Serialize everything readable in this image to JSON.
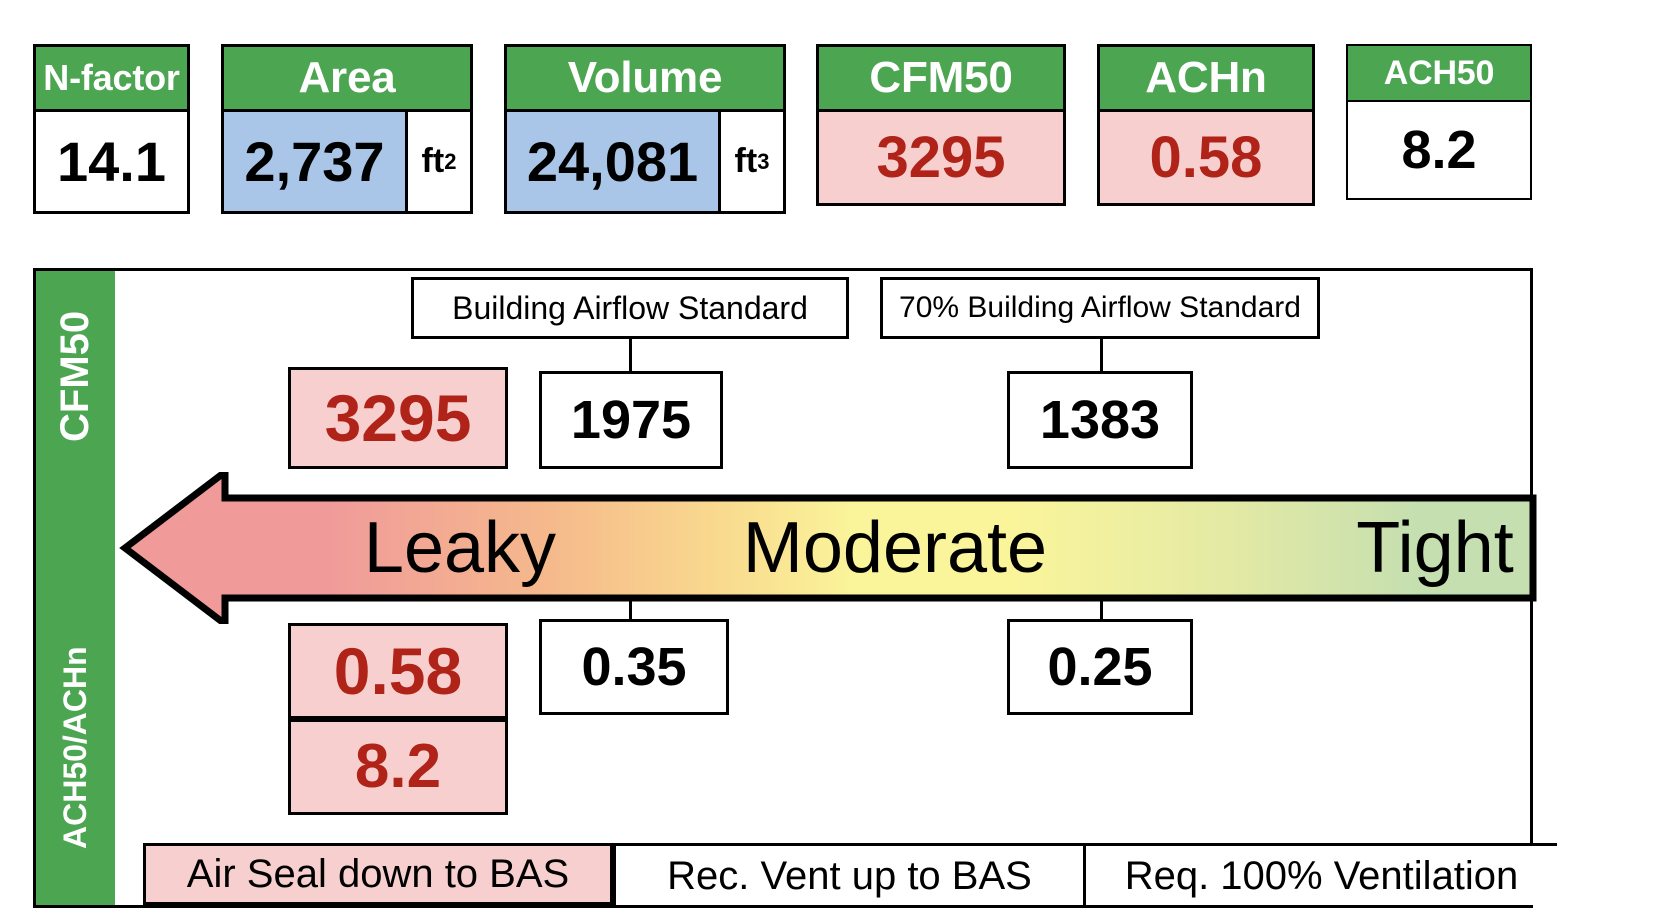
{
  "summary": {
    "cards": [
      {
        "id": "nfactor",
        "label": "N-factor",
        "value": "14.1",
        "unit": "",
        "unit_sup": ""
      },
      {
        "id": "area",
        "label": "Area",
        "value": "2,737",
        "unit": "ft",
        "unit_sup": "2"
      },
      {
        "id": "volume",
        "label": "Volume",
        "value": "24,081",
        "unit": "ft",
        "unit_sup": "3"
      },
      {
        "id": "cfm50",
        "label": "CFM50",
        "value": "3295",
        "unit": "",
        "unit_sup": ""
      },
      {
        "id": "achn",
        "label": "ACHn",
        "value": "0.58",
        "unit": "",
        "unit_sup": ""
      },
      {
        "id": "ach50",
        "label": "ACH50",
        "value": "8.2",
        "unit": "",
        "unit_sup": ""
      }
    ]
  },
  "panel": {
    "sidebar": {
      "top_label": "CFM50",
      "bottom_label": "ACH50/ACHn"
    },
    "standards": {
      "bas_label": "Building Airflow Standard",
      "bas70_label": "70% Building Airflow Standard"
    },
    "cfm_row": {
      "actual": "3295",
      "bas": "1975",
      "bas70": "1383"
    },
    "ach_row": {
      "achn_actual": "0.58",
      "ach50_actual": "8.2",
      "achn_bas": "0.35",
      "achn_bas70": "0.25"
    },
    "band": {
      "leaky": "Leaky",
      "moderate": "Moderate",
      "tight": "Tight"
    },
    "actions": {
      "seal": "Air Seal down to BAS",
      "vent": "Rec. Vent up to BAS",
      "required": "Req. 100% Ventilation"
    }
  },
  "colors": {
    "green_header": "#4CA551",
    "blue_cell": "#A9C6E8",
    "pink_cell": "#F7CFCF",
    "red_text": "#B02318",
    "arrow_salmon": "#F09A9A",
    "band_yellow": "#FAF59B",
    "band_green": "#C5DFB0"
  }
}
